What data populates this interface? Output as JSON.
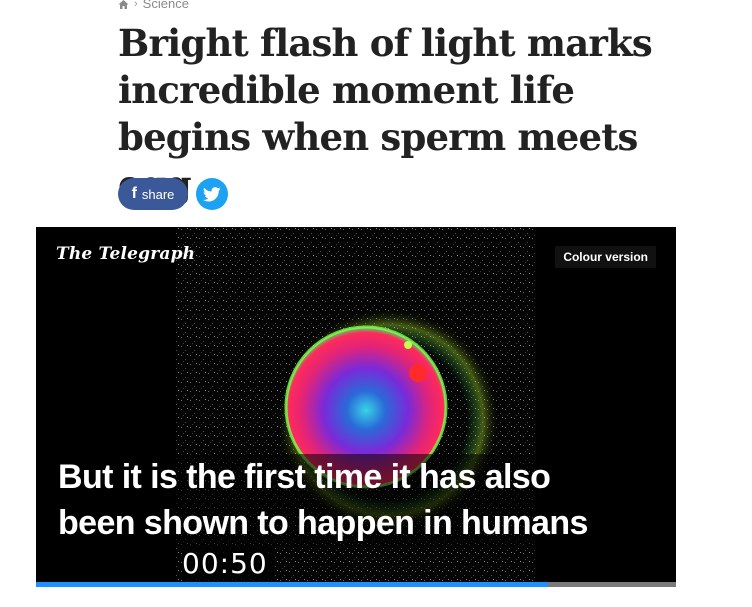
{
  "breadcrumb": {
    "icon": "home-icon",
    "section": "Science"
  },
  "headline": {
    "line1": "Bright flash of light marks",
    "line2": "incredible moment life",
    "line3": "begins when sperm meets egg"
  },
  "share": {
    "facebook_label": "share",
    "facebook_color": "#3b5998",
    "twitter_color": "#1da1f2"
  },
  "video": {
    "brand": "The Telegraph",
    "badge": "Colour version",
    "caption_line1": "But it is the first time it has also",
    "caption_line2": "been shown to happen in humans",
    "timestamp": "00:50",
    "progress_fraction": 0.8,
    "progress_color": "#1e90ff"
  }
}
